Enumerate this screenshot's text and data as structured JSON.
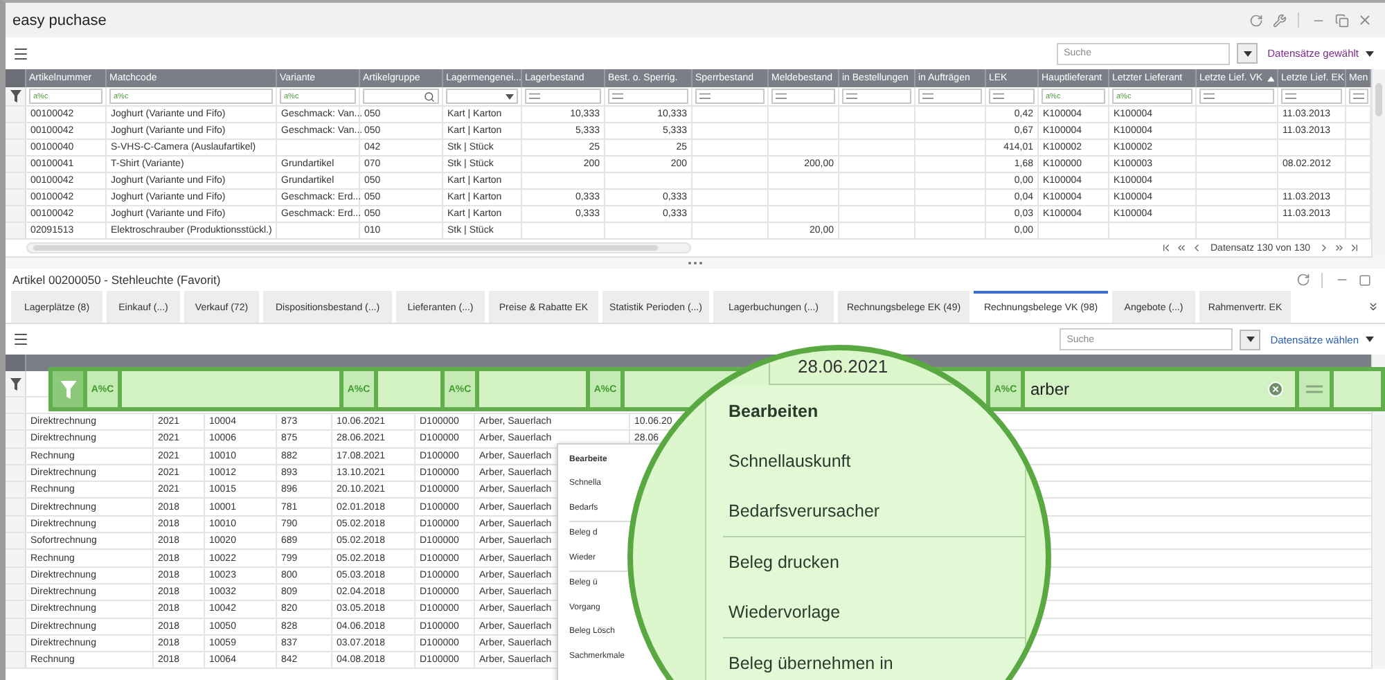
{
  "window": {
    "title": "easy puchase"
  },
  "toolbar": {
    "search": {
      "placeholder": "Suche"
    },
    "records_menu": "Datensätze gewählt"
  },
  "grid": {
    "columns": [
      {
        "label": "Artikelnummer",
        "kind": "text",
        "op": "a%c"
      },
      {
        "label": "Matchcode",
        "kind": "text",
        "op": "a%c"
      },
      {
        "label": "Variante",
        "kind": "text",
        "op": "a%c"
      },
      {
        "label": "Artikelgruppe",
        "kind": "search"
      },
      {
        "label": "Lagermengenei...",
        "kind": "select"
      },
      {
        "label": "Lagerbestand",
        "kind": "number"
      },
      {
        "label": "Best. o. Sperrig.",
        "kind": "number"
      },
      {
        "label": "Sperrbestand",
        "kind": "number"
      },
      {
        "label": "Meldebestand",
        "kind": "number"
      },
      {
        "label": "in Bestellungen",
        "kind": "number"
      },
      {
        "label": "in Aufträgen",
        "kind": "number"
      },
      {
        "label": "LEK",
        "kind": "number"
      },
      {
        "label": "Hauptlieferant",
        "kind": "text",
        "op": "a%c"
      },
      {
        "label": "Letzter Lieferant",
        "kind": "text",
        "op": "a%c"
      },
      {
        "label": "Letzte Lief. VK",
        "kind": "date",
        "sorted": true
      },
      {
        "label": "Letzte Lief. EK",
        "kind": "date"
      },
      {
        "label": "Men",
        "kind": "date"
      }
    ],
    "rows": [
      [
        "00100042",
        "Joghurt (Variante und Fifo)",
        "Geschmack: Van...",
        "050",
        "Kart  |  Karton",
        "10,333",
        "10,333",
        null,
        null,
        null,
        null,
        "0,42",
        "K100004",
        "K100004",
        null,
        "11.03.2013",
        null
      ],
      [
        "00100042",
        "Joghurt (Variante und Fifo)",
        "Geschmack: Van...",
        "050",
        "Kart  |  Karton",
        "5,333",
        "5,333",
        null,
        null,
        null,
        null,
        "0,67",
        "K100004",
        "K100004",
        null,
        "11.03.2013",
        null
      ],
      [
        "00100040",
        "S-VHS-C-Camera (Auslaufartikel)",
        null,
        "042",
        "Stk  |  Stück",
        "25",
        "25",
        null,
        null,
        null,
        null,
        "414,01",
        "K100002",
        "K100002",
        null,
        null,
        null
      ],
      [
        "00100041",
        "T-Shirt (Variante)",
        "Grundartikel",
        "070",
        "Stk  |  Stück",
        "200",
        "200",
        null,
        "200,00",
        null,
        null,
        "1,68",
        "K100000",
        "K100003",
        null,
        "08.02.2012",
        null
      ],
      [
        "00100042",
        "Joghurt (Variante und Fifo)",
        "Grundartikel",
        "050",
        "Kart  |  Karton",
        null,
        null,
        null,
        null,
        null,
        null,
        "0,00",
        "K100004",
        "K100004",
        null,
        null,
        null
      ],
      [
        "00100042",
        "Joghurt (Variante und Fifo)",
        "Geschmack: Erd...",
        "050",
        "Kart  |  Karton",
        "0,333",
        "0,333",
        null,
        null,
        null,
        null,
        "0,04",
        "K100004",
        "K100004",
        null,
        "11.03.2013",
        null
      ],
      [
        "00100042",
        "Joghurt (Variante und Fifo)",
        "Geschmack: Erd...",
        "050",
        "Kart  |  Karton",
        "0,333",
        "0,333",
        null,
        null,
        null,
        null,
        "0,03",
        "K100004",
        "K100004",
        null,
        "11.03.2013",
        null
      ],
      [
        "02091513",
        "Elektroschrauber (Produktionsstückl.)",
        null,
        "010",
        "Stk  |  Stück",
        null,
        null,
        null,
        "20,00",
        null,
        null,
        "0,00",
        null,
        null,
        null,
        null,
        null
      ]
    ]
  },
  "pager": {
    "text": "Datensatz 130 von 130"
  },
  "detail": {
    "title": "Artikel 00200050 - Stehleuchte (Favorit)",
    "tabs": [
      {
        "label": "Lagerplätze (8)",
        "selected": false
      },
      {
        "label": "Einkauf (...)",
        "selected": false
      },
      {
        "label": "Verkauf (72)",
        "selected": false
      },
      {
        "label": "Dispositionsbestand (...)",
        "selected": false
      },
      {
        "label": "Lieferanten (...)",
        "selected": false
      },
      {
        "label": "Preise & Rabatte EK",
        "selected": false
      },
      {
        "label": "Statistik Perioden (...)",
        "selected": false
      },
      {
        "label": "Lagerbuchungen (...)",
        "selected": false
      },
      {
        "label": "Rechnungsbelege EK (49)",
        "selected": false
      },
      {
        "label": "Rechnungsbelege VK (98)",
        "selected": true
      },
      {
        "label": "Angebote (...)",
        "selected": false
      },
      {
        "label": "Rahmenvertr. EK",
        "selected": false
      }
    ],
    "toolbar": {
      "search": {
        "placeholder": "Suche"
      },
      "records_menu": "Datensätze wählen"
    },
    "rows": [
      [
        "Direktrechnung",
        "2021",
        "10004",
        "873",
        "10.06.2021",
        "D100000",
        "Arber, Sauerlach",
        "10.06.20"
      ],
      [
        "Direktrechnung",
        "2021",
        "10006",
        "875",
        "28.06.2021",
        "D100000",
        "Arber, Sauerlach",
        "28.06"
      ],
      [
        "Rechnung",
        "2021",
        "10010",
        "882",
        "17.08.2021",
        "D100000",
        "Arber, Sauerlach"
      ],
      [
        "Direktrechnung",
        "2021",
        "10012",
        "893",
        "13.10.2021",
        "D100000",
        "Arber, Sauerlach"
      ],
      [
        "Rechnung",
        "2021",
        "10015",
        "896",
        "20.10.2021",
        "D100000",
        "Arber, Sauerlach"
      ],
      [
        "Direktrechnung",
        "2018",
        "10001",
        "781",
        "02.01.2018",
        "D100000",
        "Arber, Sauerlach"
      ],
      [
        "Direktrechnung",
        "2018",
        "10010",
        "790",
        "05.02.2018",
        "D100000",
        "Arber, Sauerlach"
      ],
      [
        "Sofortrechnung",
        "2018",
        "10020",
        "689",
        "05.02.2018",
        "D100000",
        "Arber, Sauerlach"
      ],
      [
        "Rechnung",
        "2018",
        "10022",
        "799",
        "05.02.2018",
        "D100000",
        "Arber, Sauerlach"
      ],
      [
        "Direktrechnung",
        "2018",
        "10023",
        "800",
        "05.03.2018",
        "D100000",
        "Arber, Sauerlach"
      ],
      [
        "Direktrechnung",
        "2018",
        "10032",
        "809",
        "02.04.2018",
        "D100000",
        "Arber, Sauerlach"
      ],
      [
        "Direktrechnung",
        "2018",
        "10042",
        "820",
        "03.05.2018",
        "D100000",
        "Arber, Sauerlach"
      ],
      [
        "Direktrechnung",
        "2018",
        "10050",
        "828",
        "04.06.2018",
        "D100000",
        "Arber, Sauerlach"
      ],
      [
        "Direktrechnung",
        "2018",
        "10059",
        "837",
        "03.07.2018",
        "D100000",
        "Arber, Sauerlach"
      ],
      [
        "Rechnung",
        "2018",
        "10064",
        "842",
        "04.08.2018",
        "D100000",
        "Arber, Sauerlach"
      ]
    ]
  },
  "filter_bar": {
    "segments": [
      {
        "kind": "funnel"
      },
      {
        "kind": "op",
        "label": "A%C"
      },
      {
        "kind": "field"
      },
      {
        "kind": "op",
        "label": "A%C"
      },
      {
        "kind": "field"
      },
      {
        "kind": "op",
        "label": "A%C"
      },
      {
        "kind": "field"
      },
      {
        "kind": "op",
        "label": "A%C"
      },
      {
        "kind": "field"
      },
      {
        "kind": "op",
        "label": "A%C"
      },
      {
        "kind": "field",
        "value": "arber"
      },
      {
        "kind": "equals"
      },
      {
        "kind": "field"
      }
    ]
  },
  "context_menu": {
    "items": [
      {
        "kind": "default",
        "label": "Bearbeite"
      },
      {
        "kind": "item",
        "label": "Schnella"
      },
      {
        "kind": "item",
        "label": "Bedarfs"
      },
      {
        "kind": "separator"
      },
      {
        "kind": "item",
        "label": "Beleg d"
      },
      {
        "kind": "item",
        "label": "Wieder"
      },
      {
        "kind": "separator"
      },
      {
        "kind": "item",
        "label": "Beleg ü"
      },
      {
        "kind": "item",
        "label": "Vorgang"
      },
      {
        "kind": "item",
        "label": "Beleg Lösch"
      },
      {
        "kind": "item",
        "label": "Sachmerkmale"
      }
    ]
  },
  "magnifier": {
    "cell": "28.06.2021",
    "items": [
      {
        "kind": "default",
        "label": "Bearbeiten"
      },
      {
        "kind": "item",
        "label": "Schnellauskunft"
      },
      {
        "kind": "item",
        "label": "Bedarfsverursacher"
      },
      {
        "kind": "separator"
      },
      {
        "kind": "item",
        "label": "Beleg drucken"
      },
      {
        "kind": "item",
        "label": "Wiedervorlage"
      },
      {
        "kind": "separator"
      },
      {
        "kind": "item",
        "label": "Beleg übernehmen in"
      }
    ]
  }
}
